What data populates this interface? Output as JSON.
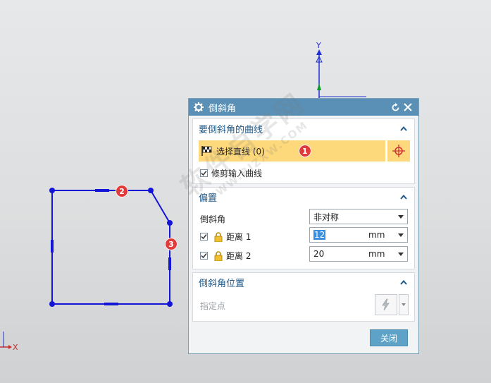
{
  "viewport": {
    "axis_y": "Y",
    "axis_x": "X",
    "badges": [
      "1",
      "2",
      "3"
    ]
  },
  "watermark": {
    "line1": "软件自学网",
    "line2": "WWW.RJZXW.COM"
  },
  "dialog": {
    "title": "倒斜角",
    "section_curves": {
      "header": "要倒斜角的曲线",
      "select_label": "选择直线 (0)",
      "trim_label": "修剪输入曲线",
      "trim_checked": true
    },
    "section_offset": {
      "header": "偏置",
      "chamfer_label": "倒斜角",
      "chamfer_value": "非对称",
      "distance1_label": "距离 1",
      "distance1_value": "12",
      "distance1_unit": "mm",
      "distance2_label": "距离 2",
      "distance2_value": "20",
      "distance2_unit": "mm"
    },
    "section_position": {
      "header": "倒斜角位置",
      "point_label": "指定点"
    },
    "close_label": "关闭"
  },
  "colors": {
    "sketch": "#1515d8",
    "title_bar": "#5a90b5",
    "selection": "#fdd97c",
    "badge": "#e23a3a"
  }
}
